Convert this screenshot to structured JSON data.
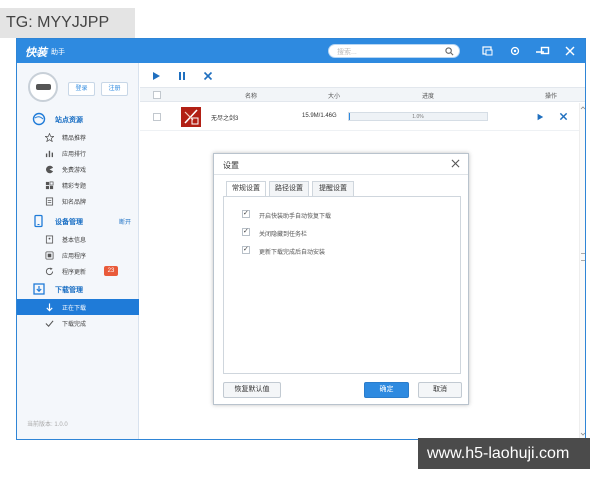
{
  "watermark_top": "TG: MYYJJPP",
  "watermark_bottom": "www.h5-laohuji.com",
  "app": {
    "logo": "快装",
    "logo_sub": "助手",
    "search_placeholder": "搜索..."
  },
  "colors": {
    "accent": "#2e8ae0",
    "active": "#1f7bd8",
    "badge": "#e95a3a"
  },
  "sidebar": {
    "login": "登录",
    "register": "注册",
    "sections": [
      {
        "title": "站点资源",
        "icon": "globe-icon",
        "action": "",
        "items": [
          {
            "label": "精品推荐",
            "icon": "star-icon"
          },
          {
            "label": "应用排行",
            "icon": "bar-chart-icon"
          },
          {
            "label": "免费游戏",
            "icon": "pacman-icon"
          },
          {
            "label": "精彩专题",
            "icon": "grid-icon"
          },
          {
            "label": "知名品牌",
            "icon": "brand-icon"
          }
        ]
      },
      {
        "title": "设备管理",
        "icon": "device-icon",
        "action": "断开",
        "items": [
          {
            "label": "基本信息",
            "icon": "info-icon"
          },
          {
            "label": "应用程序",
            "icon": "apps-icon"
          },
          {
            "label": "程序更新",
            "icon": "refresh-icon",
            "badge": "23"
          }
        ]
      },
      {
        "title": "下载管理",
        "icon": "download-manager-icon",
        "action": "",
        "items": [
          {
            "label": "正在下载",
            "icon": "download-arrow-icon",
            "active": true
          },
          {
            "label": "下载完成",
            "icon": "check-icon"
          }
        ]
      }
    ],
    "version": "当前版本: 1.0.0"
  },
  "table": {
    "columns": {
      "name": "名称",
      "size": "大小",
      "progress": "进度",
      "action": "操作"
    },
    "rows": [
      {
        "name": "无尽之剑3",
        "size": "15.9M/1.46G",
        "progress_text": "1.0%",
        "progress": 0.01
      }
    ]
  },
  "dialog": {
    "title": "设置",
    "tabs": [
      "常规设置",
      "路径设置",
      "提醒设置"
    ],
    "options": [
      "开启快装助手自动恢复下载",
      "关闭隐藏到任务栏",
      "更新下载完成后自动安装"
    ],
    "restore_default": "恢复默认值",
    "confirm": "确定",
    "cancel": "取消"
  }
}
